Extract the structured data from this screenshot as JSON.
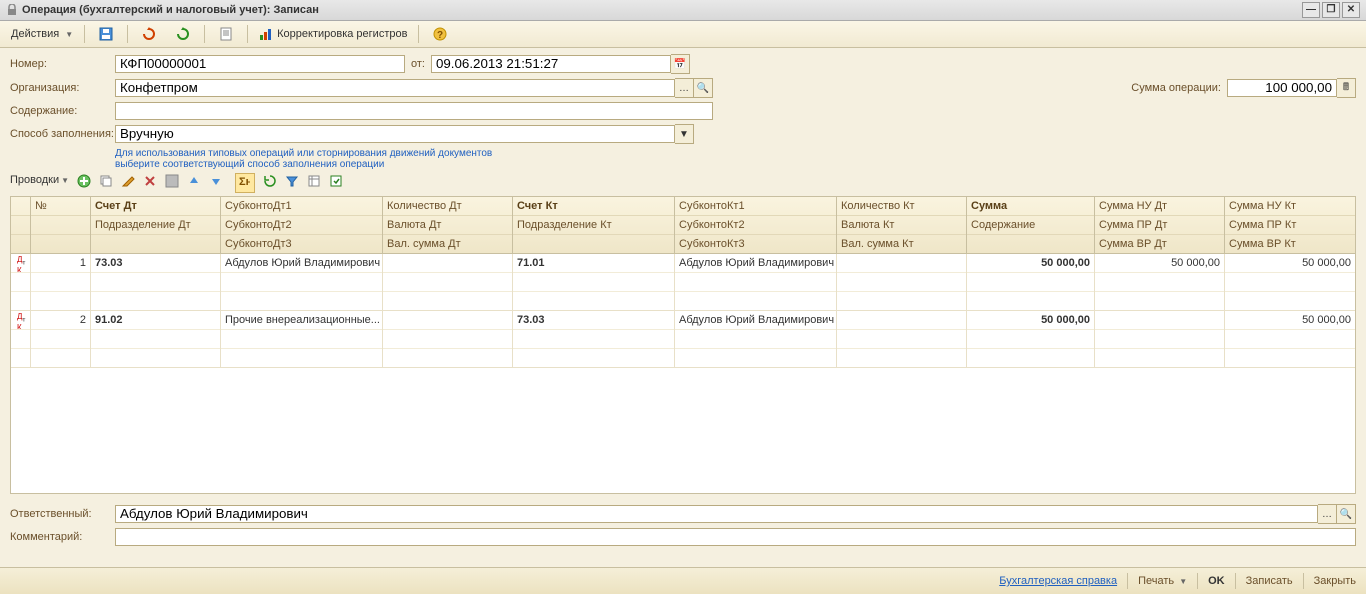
{
  "title": "Операция (бухгалтерский и налоговый учет): Записан",
  "toolbar": {
    "actions": "Действия",
    "registers": "Корректировка регистров"
  },
  "form": {
    "number_label": "Номер:",
    "number": "КФП00000001",
    "date_label": "от:",
    "date": "09.06.2013 21:51:27",
    "org_label": "Организация:",
    "org": "Конфетпром",
    "sum_label": "Сумма операции:",
    "sum": "100 000,00",
    "content_label": "Содержание:",
    "content": "",
    "fill_label": "Способ заполнения:",
    "fill_value": "Вручную",
    "hint_line1": "Для использования типовых операций или сторнирования движений документов",
    "hint_line2": "выберите соответствующий способ заполнения операции",
    "entries_label": "Проводки"
  },
  "grid": {
    "headers": {
      "num": "№",
      "acc_dt": [
        "Счет Дт",
        "Подразделение Дт",
        ""
      ],
      "sub_dt": [
        "СубконтоДт1",
        "СубконтоДт2",
        "СубконтоДт3"
      ],
      "qty_dt": [
        "Количество Дт",
        "Валюта Дт",
        "Вал. сумма Дт"
      ],
      "acc_kt": [
        "Счет Кт",
        "Подразделение Кт",
        ""
      ],
      "sub_kt": [
        "СубконтоКт1",
        "СубконтоКт2",
        "СубконтоКт3"
      ],
      "qty_kt": [
        "Количество Кт",
        "Валюта Кт",
        "Вал. сумма Кт"
      ],
      "sum": [
        "Сумма",
        "Содержание",
        ""
      ],
      "sum_nu_dt": [
        "Сумма НУ Дт",
        "Сумма ПР Дт",
        "Сумма ВР Дт"
      ],
      "sum_nu_kt": [
        "Сумма НУ Кт",
        "Сумма ПР Кт",
        "Сумма ВР Кт"
      ]
    },
    "rows": [
      {
        "num": "1",
        "acc_dt": "73.03",
        "sub_dt": "Абдулов Юрий Владимирович",
        "acc_kt": "71.01",
        "sub_kt": "Абдулов Юрий Владимирович",
        "sum": "50 000,00",
        "sum_nu_dt": "50 000,00",
        "sum_nu_kt": "50 000,00"
      },
      {
        "num": "2",
        "acc_dt": "91.02",
        "sub_dt": "Прочие внереализационные...",
        "acc_kt": "73.03",
        "sub_kt": "Абдулов Юрий Владимирович",
        "sum": "50 000,00",
        "sum_nu_dt": "",
        "sum_nu_kt": "50 000,00"
      }
    ]
  },
  "bottom": {
    "responsible_label": "Ответственный:",
    "responsible": "Абдулов Юрий Владимирович",
    "comment_label": "Комментарий:",
    "comment": ""
  },
  "footer": {
    "report": "Бухгалтерская справка",
    "print": "Печать",
    "ok": "OK",
    "save": "Записать",
    "close": "Закрыть"
  }
}
